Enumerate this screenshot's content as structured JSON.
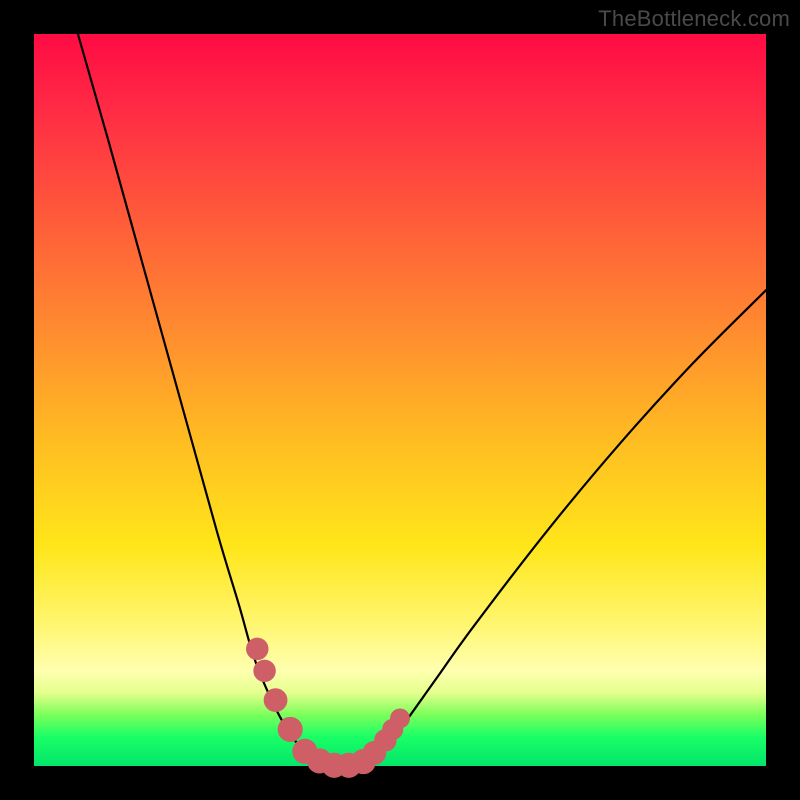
{
  "watermark": "TheBottleneck.com",
  "colors": {
    "frame": "#000000",
    "curve_stroke": "#000000",
    "marker_fill": "#cf5f67",
    "gradient_top": "#ff0b43",
    "gradient_bottom": "#02e56a"
  },
  "chart_data": {
    "type": "line",
    "title": "",
    "xlabel": "",
    "ylabel": "",
    "xlim": [
      0,
      100
    ],
    "ylim": [
      0,
      100
    ],
    "grid": false,
    "series": [
      {
        "name": "bottleneck-curve-left",
        "x": [
          6,
          10,
          15,
          20,
          25,
          28,
          30,
          32,
          34,
          36,
          37,
          38,
          39
        ],
        "y": [
          100,
          86,
          68,
          50,
          32,
          22,
          15,
          10,
          6,
          3,
          1.5,
          0.7,
          0.3
        ]
      },
      {
        "name": "bottleneck-floor",
        "x": [
          39,
          40,
          41,
          42,
          43,
          44,
          45,
          46
        ],
        "y": [
          0.3,
          0.08,
          0.02,
          0.0,
          0.02,
          0.08,
          0.3,
          0.8
        ]
      },
      {
        "name": "bottleneck-curve-right",
        "x": [
          46,
          48,
          50,
          55,
          60,
          70,
          80,
          90,
          100
        ],
        "y": [
          0.8,
          2.5,
          5,
          12,
          19,
          32,
          44,
          55,
          65
        ]
      }
    ],
    "markers": [
      {
        "x": 30.5,
        "y": 16,
        "r": 1.1
      },
      {
        "x": 31.5,
        "y": 13,
        "r": 1.1
      },
      {
        "x": 33.0,
        "y": 9,
        "r": 1.2
      },
      {
        "x": 35.0,
        "y": 5,
        "r": 1.3
      },
      {
        "x": 37.0,
        "y": 2,
        "r": 1.3
      },
      {
        "x": 39.0,
        "y": 0.7,
        "r": 1.3
      },
      {
        "x": 41.0,
        "y": 0.1,
        "r": 1.3
      },
      {
        "x": 43.0,
        "y": 0.1,
        "r": 1.3
      },
      {
        "x": 45.0,
        "y": 0.6,
        "r": 1.3
      },
      {
        "x": 46.5,
        "y": 1.8,
        "r": 1.2
      },
      {
        "x": 48.0,
        "y": 3.5,
        "r": 1.1
      },
      {
        "x": 49.0,
        "y": 5.0,
        "r": 1.0
      },
      {
        "x": 50.0,
        "y": 6.5,
        "r": 0.9
      }
    ]
  }
}
